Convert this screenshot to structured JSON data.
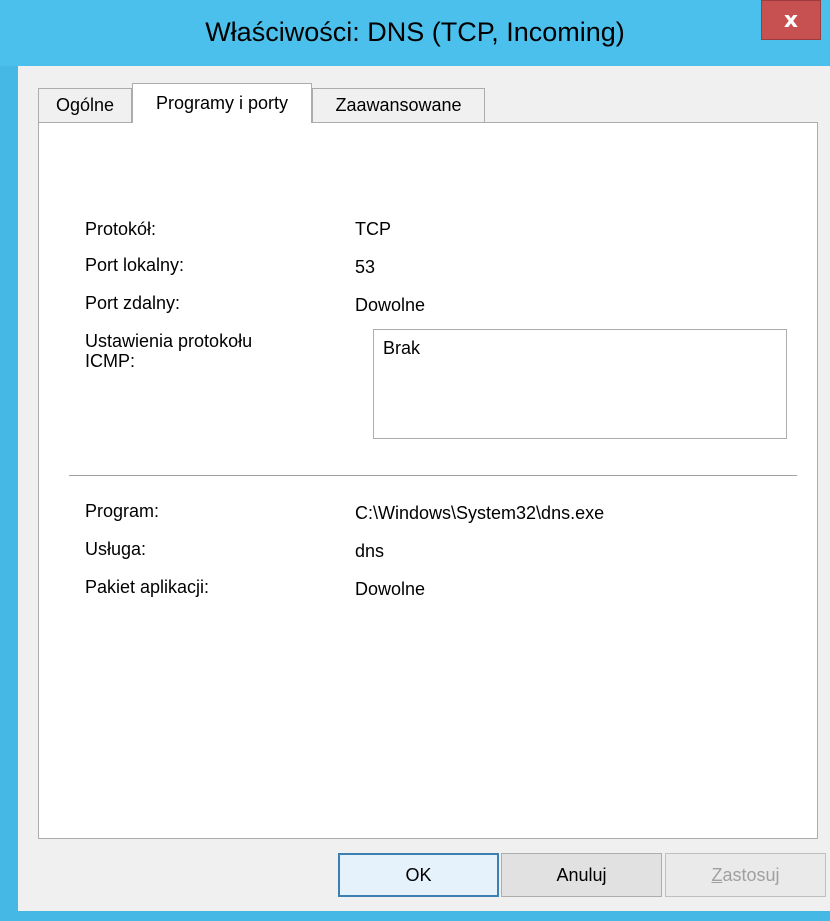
{
  "window": {
    "title": "Właściwości: DNS (TCP, Incoming)",
    "close_label": "x"
  },
  "tabs": [
    {
      "label": "Ogólne",
      "active": false
    },
    {
      "label": "Programy i porty",
      "active": true
    },
    {
      "label": "Zaawansowane",
      "active": false
    }
  ],
  "protocol_section": {
    "protocol_label": "Protokół:",
    "protocol_value": "TCP",
    "local_port_label": "Port lokalny:",
    "local_port_value": "53",
    "remote_port_label": "Port zdalny:",
    "remote_port_value": "Dowolne",
    "icmp_label": "Ustawienia protokołu\nICMP:",
    "icmp_value": "Brak"
  },
  "program_section": {
    "program_label": "Program:",
    "program_value": "C:\\Windows\\System32\\dns.exe",
    "service_label": "Usługa:",
    "service_value": "dns",
    "package_label": "Pakiet aplikacji:",
    "package_value": "Dowolne"
  },
  "buttons": {
    "ok": "OK",
    "cancel": "Anuluj",
    "apply_mnemonic": "Z",
    "apply_rest": "astosuj"
  },
  "colors": {
    "titlebar": "#4bc0ec",
    "close_button": "#c75050",
    "dialog_background": "#f0f0f0",
    "default_button_border": "#3c7fb1"
  }
}
